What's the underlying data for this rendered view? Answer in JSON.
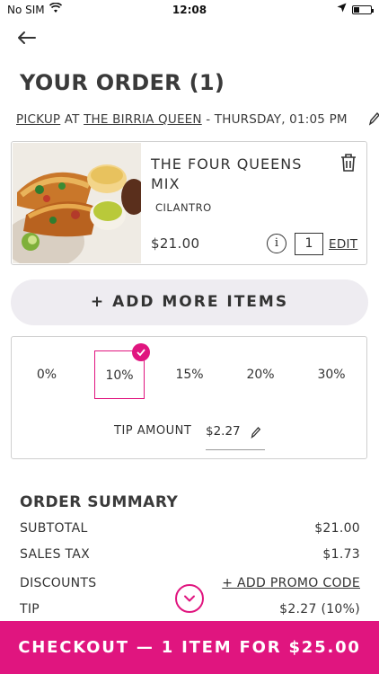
{
  "status_bar": {
    "carrier": "No SIM",
    "time": "12:08"
  },
  "header": {
    "title": "YOUR ORDER (1)"
  },
  "pickup": {
    "mode": "PICKUP",
    "at": "AT",
    "restaurant": "THE BIRRIA QUEEN",
    "when": "- THURSDAY, 01:05 PM"
  },
  "item": {
    "name": "THE FOUR QUEENS MIX",
    "modifier": "CILANTRO",
    "price": "$21.00",
    "quantity": "1",
    "edit_label": "EDIT",
    "info_glyph": "i"
  },
  "add_more_label": "+ ADD MORE ITEMS",
  "tip": {
    "options": [
      "0%",
      "10%",
      "15%",
      "20%",
      "30%"
    ],
    "selected": "10%",
    "amount_label": "TIP AMOUNT",
    "amount_value": "$2.27"
  },
  "summary": {
    "title": "ORDER SUMMARY",
    "rows": [
      {
        "label": "SUBTOTAL",
        "value": "$21.00"
      },
      {
        "label": "SALES TAX",
        "value": "$1.73"
      },
      {
        "label": "DISCOUNTS",
        "value": "+ ADD PROMO CODE"
      },
      {
        "label": "TIP",
        "value": "$2.27 (10%)"
      }
    ]
  },
  "checkout_label": "CHECKOUT — 1 ITEM FOR $25.00",
  "colors": {
    "accent": "#e0157f",
    "pill_bg": "#eeecf1",
    "text": "#333333"
  }
}
